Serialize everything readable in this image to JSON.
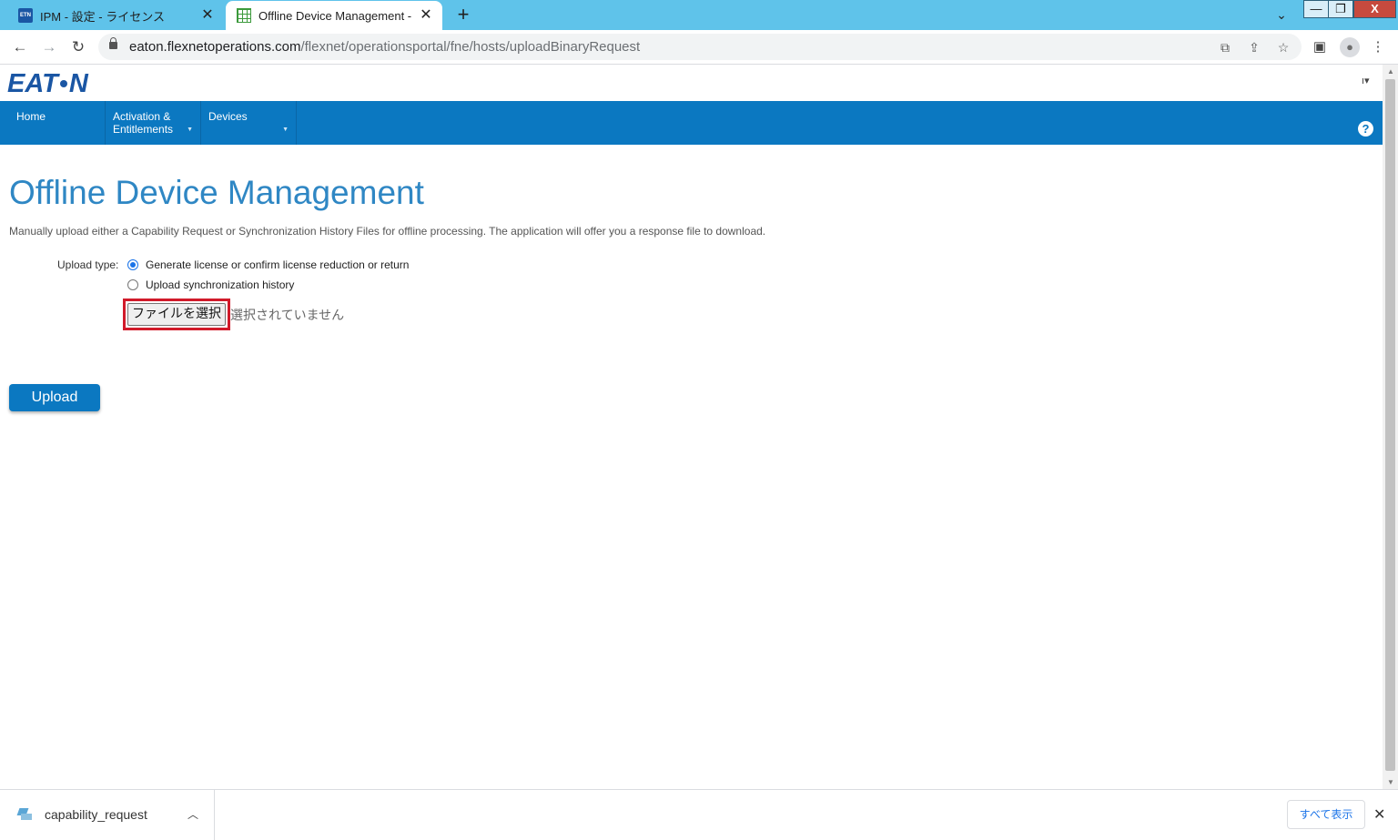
{
  "browser": {
    "tabs": [
      {
        "title": "IPM - 設定 - ライセンス",
        "favicon": "ETN",
        "active": false
      },
      {
        "title": "Offline Device Management -",
        "active": true
      }
    ],
    "new_tab": "+",
    "tab_close": "✕",
    "url_host": "eaton.flexnetoperations.com",
    "url_path": "/flexnet/operationsportal/fne/hosts/uploadBinaryRequest"
  },
  "site": {
    "logo_left": "E",
    "logo_mid": "AT",
    "logo_right": "N",
    "nav": [
      {
        "label": "Home"
      },
      {
        "label": "Activation & Entitlements"
      },
      {
        "label": "Devices"
      }
    ],
    "help": "?"
  },
  "page": {
    "title": "Offline Device Management",
    "description": "Manually upload either a Capability Request or Synchronization History Files for offline processing. The application will offer you a response file to download.",
    "upload_type_label": "Upload type:",
    "options": [
      {
        "label": "Generate license or confirm license reduction or return",
        "selected": true
      },
      {
        "label": "Upload synchronization history",
        "selected": false
      }
    ],
    "file_button": "ファイルを選択",
    "file_status": "選択されていません",
    "upload_button": "Upload"
  },
  "downloads": {
    "file_name": "capability_request",
    "show_all": "すべて表示"
  },
  "colors": {
    "tabstrip": "#5fc3ea",
    "navbar": "#0b78c1",
    "title": "#2f87c4",
    "highlight": "#d11a2a"
  }
}
